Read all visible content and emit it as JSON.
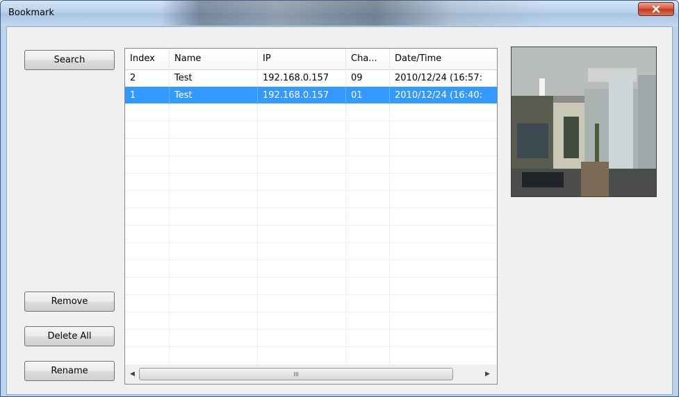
{
  "window": {
    "title": "Bookmark",
    "close_symbol": "✕"
  },
  "buttons": {
    "search": "Search",
    "remove": "Remove",
    "delete_all": "Delete All",
    "rename": "Rename"
  },
  "table": {
    "columns": [
      "Index",
      "Name",
      "IP",
      "Cha...",
      "Date/Time"
    ],
    "rows": [
      {
        "index": "2",
        "name": "Test",
        "ip": "192.168.0.157",
        "channel": "09",
        "datetime": "2010/12/24 (16:57:",
        "selected": false
      },
      {
        "index": "1",
        "name": "Test",
        "ip": "192.168.0.157",
        "channel": "01",
        "datetime": "2010/12/24 (16:40:",
        "selected": true
      }
    ]
  },
  "scrollbar": {
    "left_arrow": "◀",
    "right_arrow": "▶",
    "grip": "III"
  },
  "preview": {
    "icon": "camera-snapshot-image"
  }
}
